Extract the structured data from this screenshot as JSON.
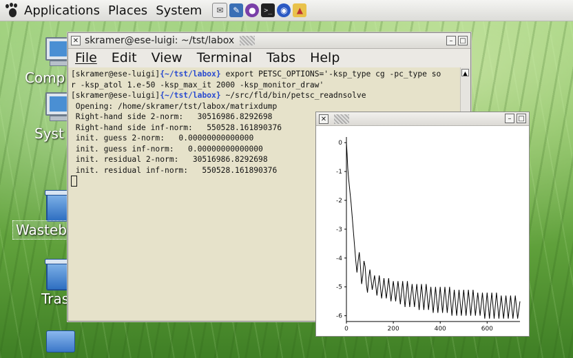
{
  "panel": {
    "menus": [
      "Applications",
      "Places",
      "System"
    ],
    "launchers": [
      "mail-icon",
      "text-editor-icon",
      "pidgin-icon",
      "terminal-icon",
      "browser-icon",
      "vlc-icon"
    ]
  },
  "desktop": {
    "icons": [
      {
        "label": "Comp"
      },
      {
        "label": "Syst"
      },
      {
        "label": "Wasteb"
      },
      {
        "label": "Tras"
      },
      {
        "label": ""
      }
    ]
  },
  "terminal": {
    "title": "skramer@ese-luigi: ~/tst/labox",
    "menu": [
      "File",
      "Edit",
      "View",
      "Terminal",
      "Tabs",
      "Help"
    ],
    "lines": [
      {
        "user": "[skramer@ese-luigi]",
        "path": "{~/tst/labox}",
        "cmd": "export PETSC_OPTIONS='-ksp_type cg -pc_type so"
      },
      {
        "text": "r -ksp_atol 1.e-50 -ksp_max_it 2000 -ksp_monitor_draw'"
      },
      {
        "user": "[skramer@ese-luigi]",
        "path": "{~/tst/labox}",
        "cmd": "~/src/fld/bin/petsc_readnsolve"
      },
      {
        "text": " Opening: /home/skramer/tst/labox/matrixdump"
      },
      {
        "text": " Right-hand side 2-norm:   30516986.8292698"
      },
      {
        "text": " Right-hand side inf-norm:   550528.161890376"
      },
      {
        "text": " init. guess 2-norm:   0.00000000000000"
      },
      {
        "text": " init. guess inf-norm:   0.00000000000000"
      },
      {
        "text": " init. residual 2-norm:   30516986.8292698"
      },
      {
        "text": " init. residual inf-norm:   550528.161890376"
      }
    ]
  },
  "chart_data": {
    "type": "line",
    "title": "",
    "xlabel": "",
    "ylabel": "",
    "xlim": [
      0,
      740
    ],
    "ylim": [
      -6.2,
      0.1
    ],
    "xticks": [
      0,
      200,
      400,
      600
    ],
    "yticks": [
      0,
      -1,
      -2,
      -3,
      -4,
      -5,
      -6
    ],
    "series": [
      {
        "x": [
          0,
          3,
          6,
          10,
          15,
          20,
          25,
          30,
          35,
          40,
          45,
          50,
          55,
          60,
          65,
          70,
          75,
          80,
          85,
          90,
          95,
          100,
          110,
          120,
          130,
          140,
          150,
          160,
          170,
          180,
          190,
          200,
          210,
          220,
          230,
          240,
          250,
          260,
          270,
          280,
          290,
          300,
          310,
          320,
          330,
          340,
          350,
          360,
          370,
          380,
          390,
          400,
          410,
          420,
          430,
          440,
          450,
          460,
          470,
          480,
          490,
          500,
          510,
          520,
          530,
          540,
          550,
          560,
          570,
          580,
          590,
          600,
          610,
          620,
          630,
          640,
          650,
          660,
          670,
          680,
          690,
          700,
          710,
          720,
          730,
          740
        ],
        "y": [
          0,
          -0.4,
          -0.9,
          -1.3,
          -1.7,
          -2.1,
          -2.6,
          -3.1,
          -3.6,
          -4.1,
          -4.5,
          -4.1,
          -3.8,
          -4.3,
          -4.9,
          -4.6,
          -4.1,
          -4.3,
          -4.9,
          -5.2,
          -4.7,
          -4.4,
          -5.1,
          -4.6,
          -5.3,
          -4.6,
          -5.4,
          -4.7,
          -5.4,
          -4.7,
          -5.5,
          -4.8,
          -5.5,
          -4.8,
          -5.6,
          -4.8,
          -5.7,
          -4.8,
          -5.7,
          -4.9,
          -5.7,
          -4.9,
          -5.8,
          -4.9,
          -5.8,
          -4.9,
          -5.8,
          -5.0,
          -5.9,
          -5.0,
          -5.9,
          -5.0,
          -5.9,
          -5.0,
          -5.9,
          -5.0,
          -6.0,
          -5.1,
          -6.0,
          -5.1,
          -6.0,
          -5.1,
          -6.0,
          -5.1,
          -6.0,
          -5.1,
          -6.0,
          -5.2,
          -6.0,
          -5.2,
          -6.1,
          -5.2,
          -6.1,
          -5.2,
          -6.1,
          -5.2,
          -6.1,
          -5.3,
          -6.1,
          -5.3,
          -6.1,
          -5.3,
          -6.1,
          -5.3,
          -6.1,
          -5.5
        ]
      }
    ]
  }
}
